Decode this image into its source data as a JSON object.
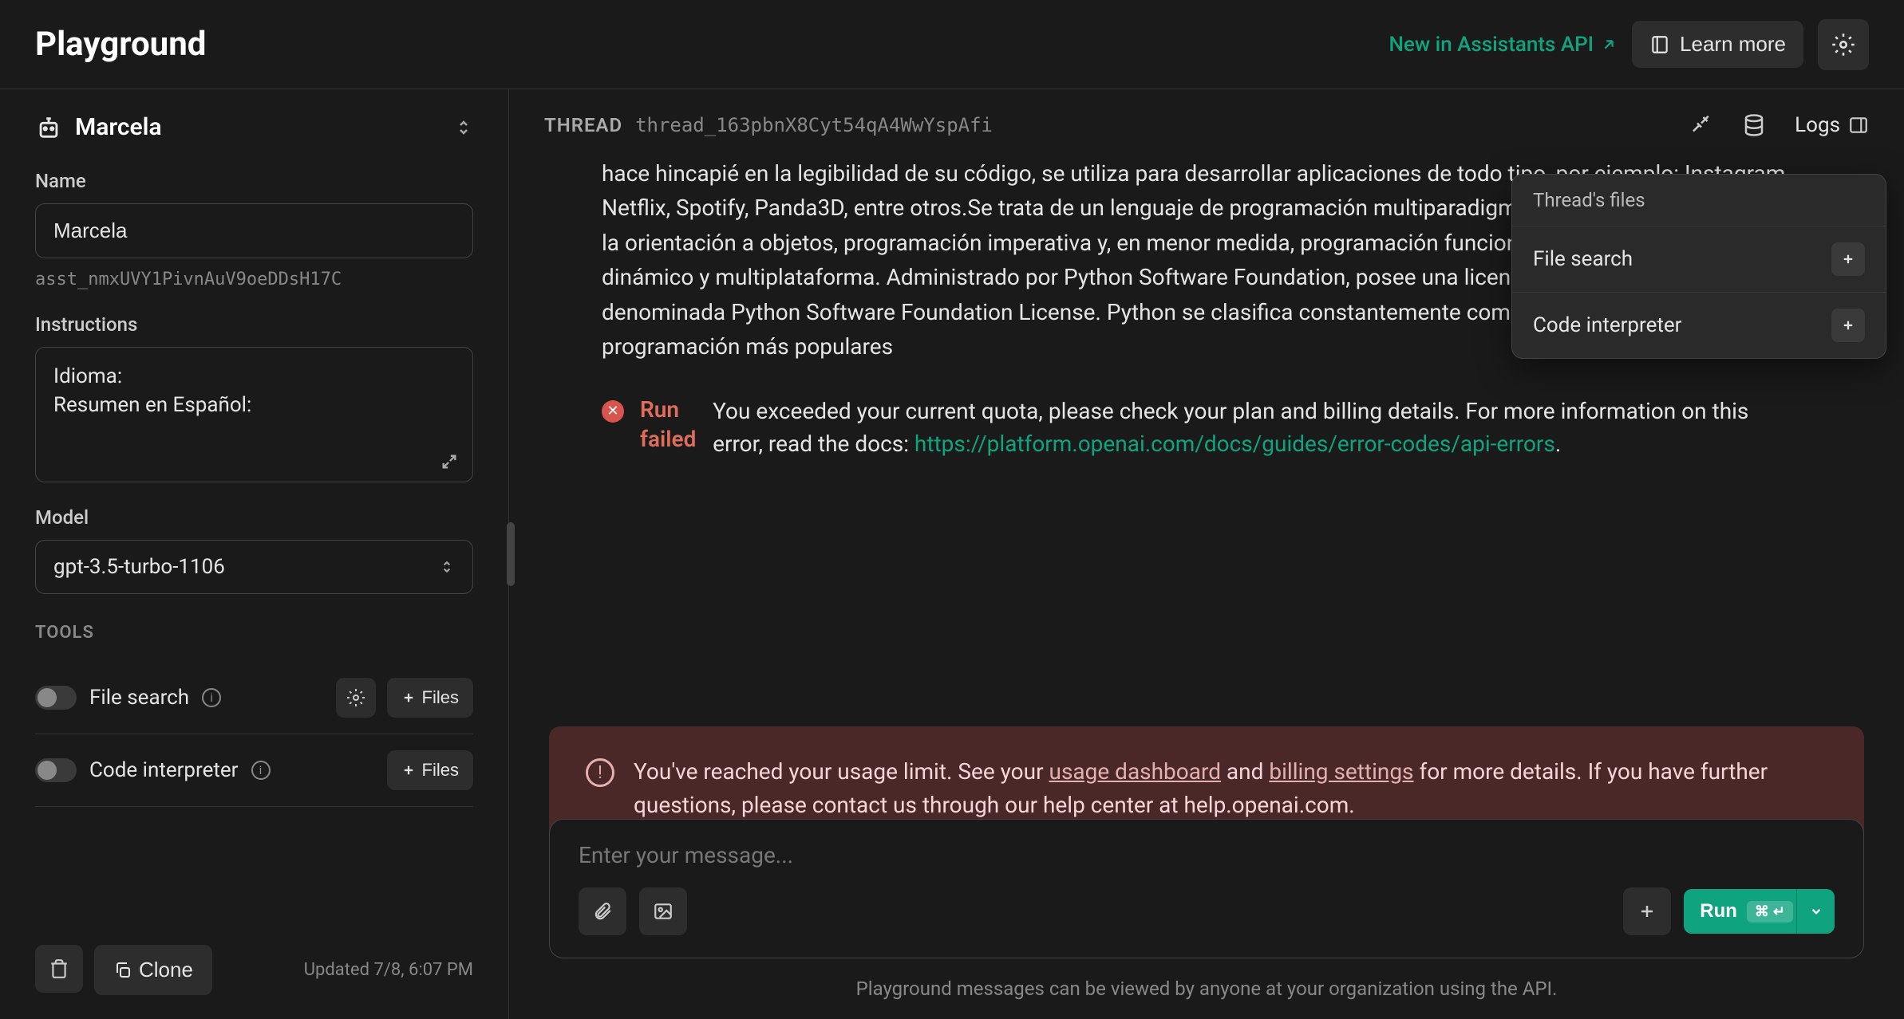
{
  "header": {
    "title": "Playground",
    "new_link": "New in Assistants API",
    "learn_more": "Learn more"
  },
  "sidebar": {
    "assistant_name_header": "Marcela",
    "name_label": "Name",
    "name_value": "Marcela",
    "asset_id": "asst_nmxUVY1PivnAuV9oeDDsH17C",
    "instructions_label": "Instructions",
    "instructions_value": "Idioma:\nResumen en Español:",
    "model_label": "Model",
    "model_value": "gpt-3.5-turbo-1106",
    "tools_label": "TOOLS",
    "tool_file_search": "File search",
    "tool_code_interpreter": "Code interpreter",
    "files_btn": "Files",
    "clone_btn": "Clone",
    "updated": "Updated 7/8, 6:07 PM"
  },
  "thread": {
    "label": "THREAD",
    "id": "thread_163pbnX8Cyt54qA4WwYspAfi",
    "logs": "Logs",
    "message_body": "hace hincapié en la legibilidad de su código, se utiliza para desarrollar aplicaciones de todo tipo, por ejemplo: Instagram, Netflix, Spotify, Panda3D, entre otros.Se trata de un lenguaje de programación multiparadigma, ya que soporta parcialmente la orientación a objetos, programación imperativa y, en menor medida, programación funcional. Es un lenguaje interpretado, dinámico y multiplataforma. Administrado por Python Software Foundation, posee una licencia de código abierto, denominada Python Software Foundation License. Python se clasifica constantemente como uno de los lenguajes de programación más populares",
    "run_failed_label": "Run failed",
    "run_failed_text_1": "You exceeded your current quota, please check your plan and billing details. For more information on this error, read the docs: ",
    "run_failed_link": "https://platform.openai.com/docs/guides/error-codes/api-errors",
    "run_failed_text_2": ".",
    "warning_prefix": "You've reached your usage limit. See your ",
    "warning_link1": "usage dashboard",
    "warning_mid": " and ",
    "warning_link2": "billing settings",
    "warning_suffix": " for more details. If you have further questions, please contact us through our help center at help.openai.com.",
    "input_placeholder": "Enter your message...",
    "run_btn": "Run",
    "run_kbd": "⌘ ↵",
    "footer_note": "Playground messages can be viewed by anyone at your organization using the API."
  },
  "popover": {
    "title": "Thread's files",
    "file_search": "File search",
    "code_interpreter": "Code interpreter"
  }
}
